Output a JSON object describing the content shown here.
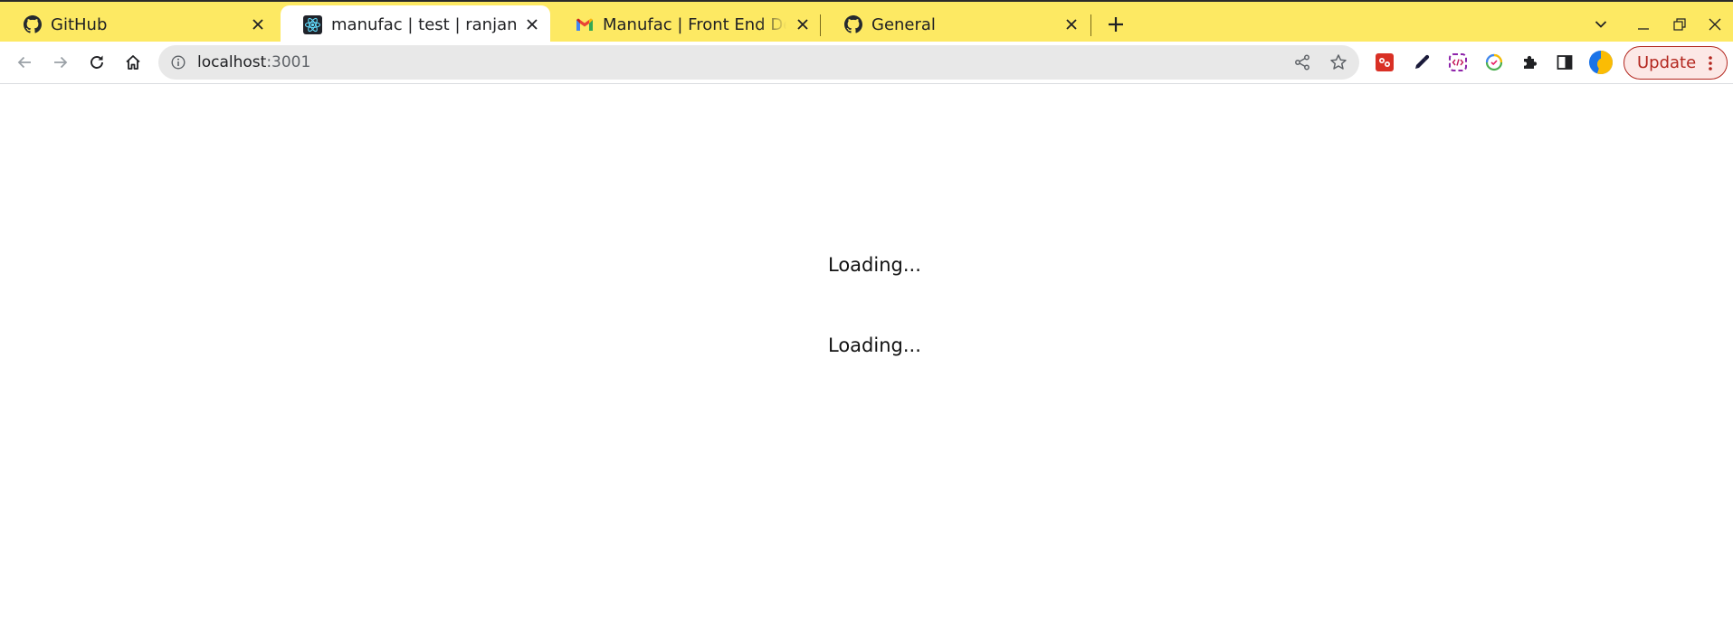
{
  "browser": {
    "tabs": [
      {
        "title": "GitHub",
        "favicon": "github-icon",
        "active": false
      },
      {
        "title": "manufac | test | ranjansh",
        "favicon": "react-icon",
        "active": true
      },
      {
        "title": "Manufac | Front End Deve",
        "favicon": "gmail-icon",
        "active": false
      },
      {
        "title": "General",
        "favicon": "github-icon",
        "active": false
      }
    ],
    "address_bar": {
      "host": "localhost",
      "port": ":3001"
    },
    "update_label": "Update",
    "extensions": [
      "extension-red-icon",
      "eyedropper-icon",
      "code-extension-icon",
      "colorful-extension-icon",
      "puzzle-icon",
      "side-panel-icon",
      "profile-avatar"
    ],
    "colors": {
      "tabstrip": "#fde963",
      "update_accent": "#b3261e"
    }
  },
  "page": {
    "loading_messages": [
      "Loading...",
      "Loading..."
    ]
  }
}
